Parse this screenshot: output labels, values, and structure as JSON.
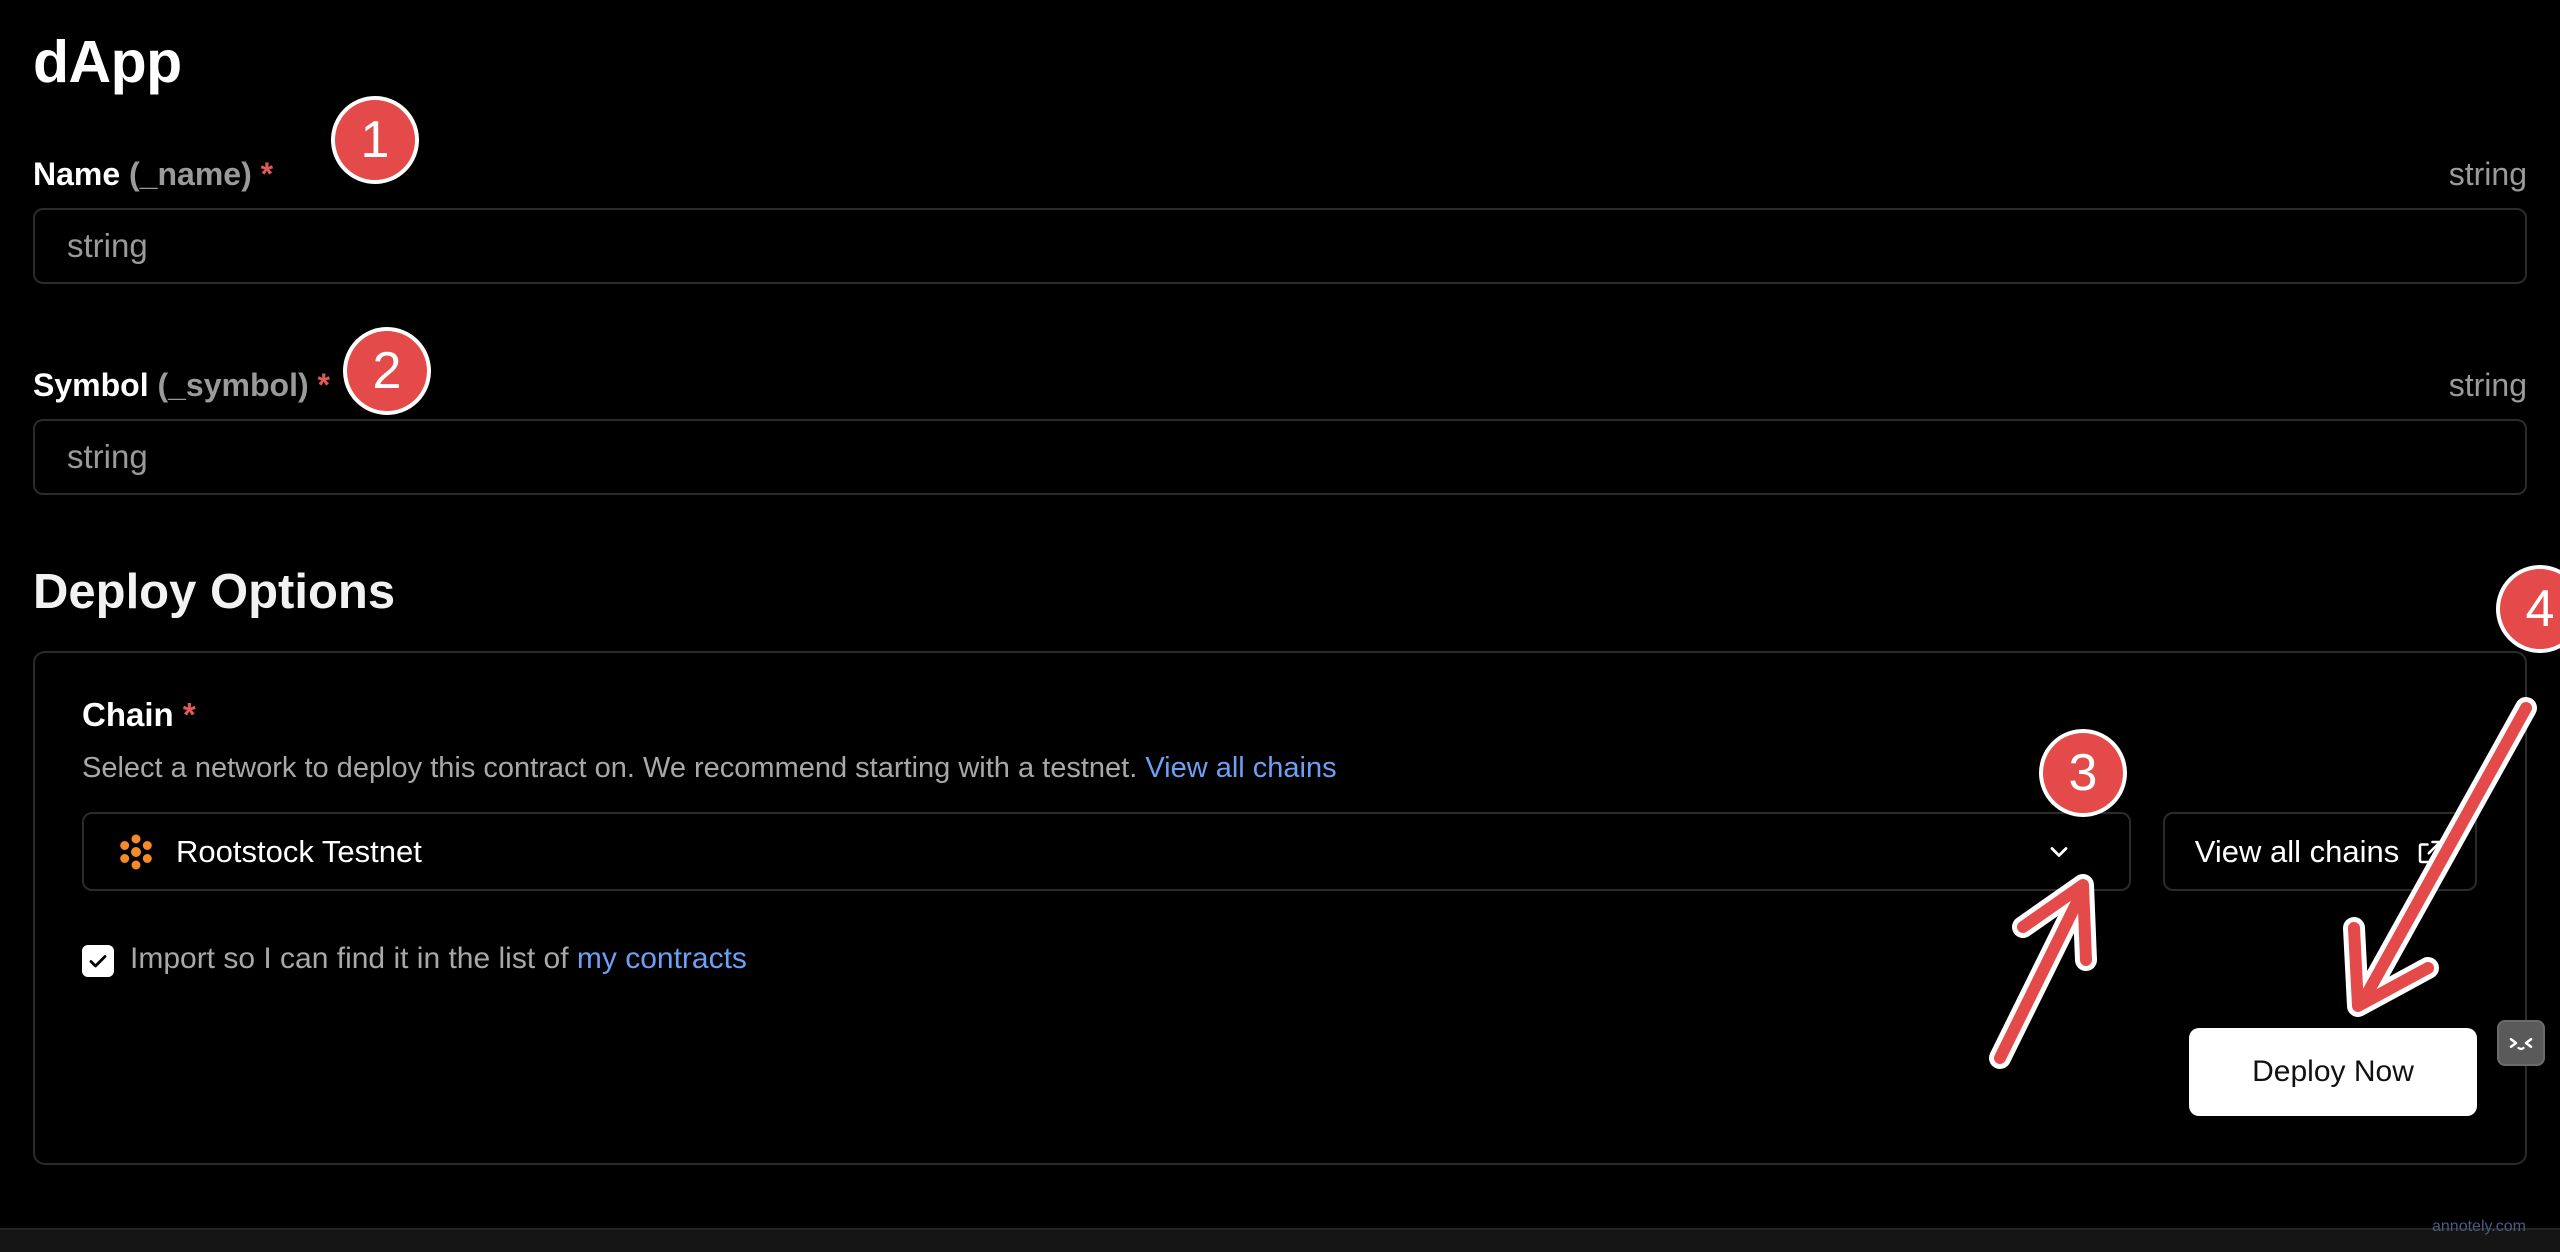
{
  "page_title": "dApp",
  "fields": [
    {
      "label": "Name",
      "param": "(_name)",
      "required_mark": "*",
      "type": "string",
      "placeholder": "string",
      "value": ""
    },
    {
      "label": "Symbol",
      "param": "(_symbol)",
      "required_mark": "*",
      "type": "string",
      "placeholder": "string",
      "value": ""
    }
  ],
  "deploy_options": {
    "heading": "Deploy Options",
    "chain": {
      "label": "Chain",
      "required_mark": "*",
      "description": "Select a network to deploy this contract on. We recommend starting with a testnet.",
      "description_link": "View all chains",
      "selected": "Rootstock Testnet",
      "chain_icon": "rootstock-icon",
      "chain_icon_color": "#f58a2a"
    },
    "view_all_chains_button": "View all chains",
    "import_checkbox": {
      "checked": true,
      "label": "Import so I can find it in the list of",
      "link": "my contracts"
    },
    "deploy_button": "Deploy Now"
  },
  "annotations": {
    "badges": [
      "1",
      "2",
      "3",
      "4"
    ],
    "color": "#e44a4a"
  },
  "watermark": "annotely.com",
  "colors": {
    "background": "#000000",
    "border": "#2b2b2b",
    "muted_text": "#9a9a9a",
    "link": "#6d9ff5",
    "required": "#e05a5a"
  }
}
